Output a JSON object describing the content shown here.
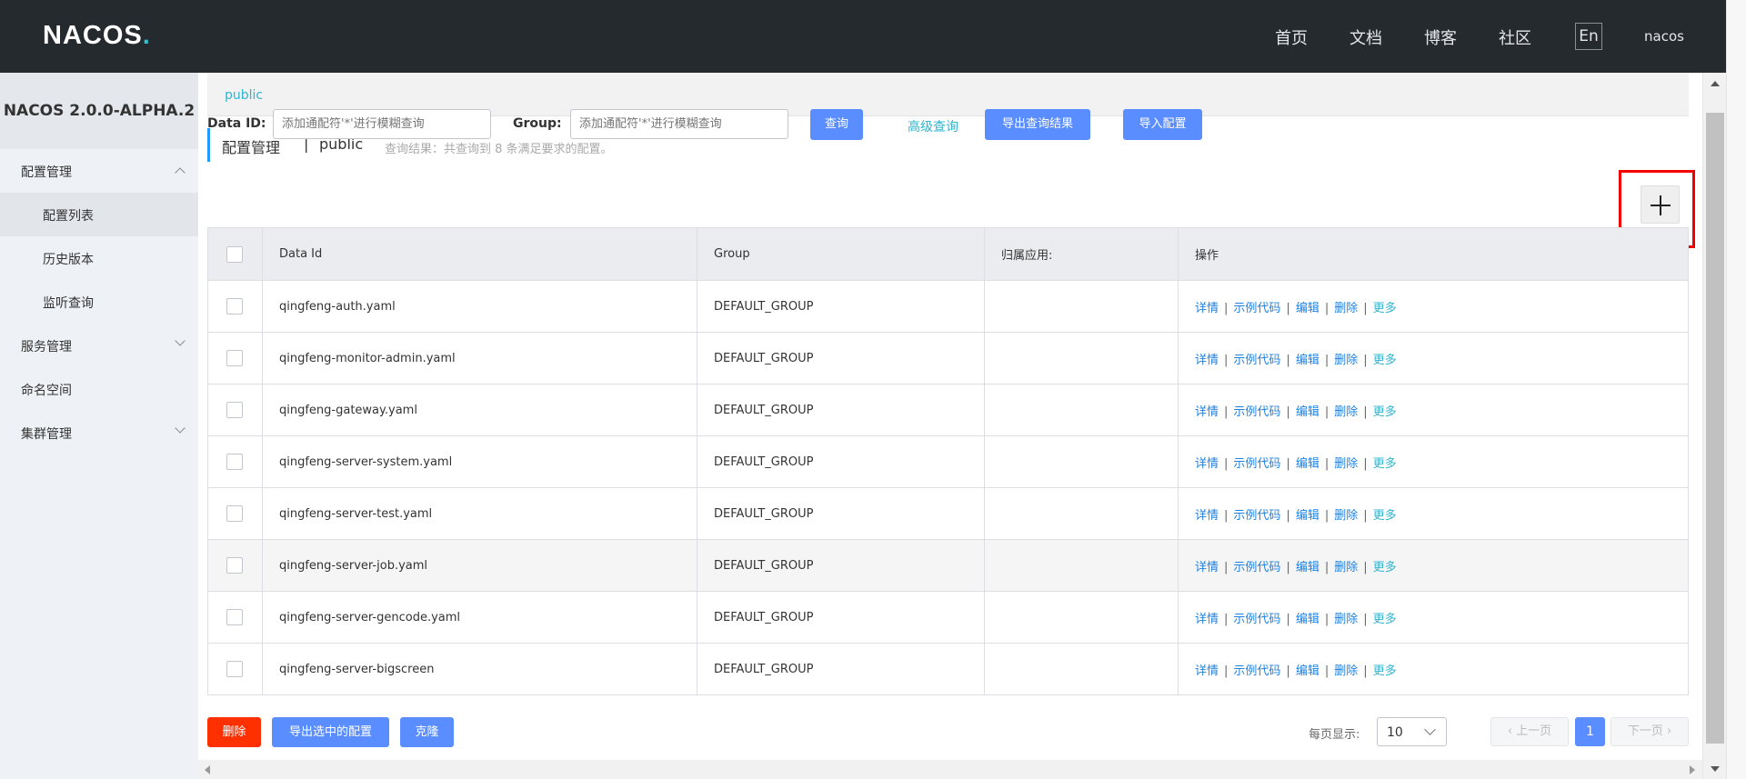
{
  "header": {
    "logo_text": "NACOS",
    "logo_dot": ".",
    "nav": [
      "首页",
      "文档",
      "博客",
      "社区"
    ],
    "lang": "En",
    "user": "nacos"
  },
  "sidebar": {
    "title": "NACOS 2.0.0-ALPHA.2",
    "items": [
      {
        "label": "配置管理",
        "expanded": true
      },
      {
        "label": "配置列表",
        "active": true
      },
      {
        "label": "历史版本"
      },
      {
        "label": "监听查询"
      },
      {
        "label": "服务管理",
        "expanded": false
      },
      {
        "label": "命名空间"
      },
      {
        "label": "集群管理",
        "expanded": false
      }
    ]
  },
  "namespace_bar": {
    "current": "public"
  },
  "page": {
    "title": "配置管理",
    "separator": "|",
    "namespace": "public",
    "result_text": "查询结果：共查询到 8 条满足要求的配置。"
  },
  "search": {
    "data_id_label": "Data ID:",
    "data_id_placeholder": "添加通配符'*'进行模糊查询",
    "group_label": "Group:",
    "group_placeholder": "添加通配符'*'进行模糊查询",
    "query_button": "查询",
    "advanced_query": "高级查询",
    "export_results": "导出查询结果",
    "import_config": "导入配置"
  },
  "table": {
    "headers": [
      "Data Id",
      "Group",
      "归属应用:",
      "操作"
    ],
    "rows": [
      {
        "data_id": "qingfeng-auth.yaml",
        "group": "DEFAULT_GROUP",
        "app": ""
      },
      {
        "data_id": "qingfeng-monitor-admin.yaml",
        "group": "DEFAULT_GROUP",
        "app": ""
      },
      {
        "data_id": "qingfeng-gateway.yaml",
        "group": "DEFAULT_GROUP",
        "app": ""
      },
      {
        "data_id": "qingfeng-server-system.yaml",
        "group": "DEFAULT_GROUP",
        "app": ""
      },
      {
        "data_id": "qingfeng-server-test.yaml",
        "group": "DEFAULT_GROUP",
        "app": ""
      },
      {
        "data_id": "qingfeng-server-job.yaml",
        "group": "DEFAULT_GROUP",
        "app": ""
      },
      {
        "data_id": "qingfeng-server-gencode.yaml",
        "group": "DEFAULT_GROUP",
        "app": ""
      },
      {
        "data_id": "qingfeng-server-bigscreen",
        "group": "DEFAULT_GROUP",
        "app": ""
      }
    ],
    "actions": {
      "detail": "详情",
      "sample_code": "示例代码",
      "edit": "编辑",
      "delete": "删除",
      "more": "更多",
      "sep": "|"
    }
  },
  "footer": {
    "delete_button": "删除",
    "export_selected_button": "导出选中的配置",
    "clone_button": "克隆",
    "page_size_label": "每页显示:",
    "page_size": "10",
    "prev": "上一页",
    "current_page": "1",
    "next": "下一页"
  },
  "colors": {
    "primary": "#5a8dff",
    "danger": "#ff3000",
    "link": "#1f81e0",
    "highlight": "#f20000",
    "header_bg": "#252a2f"
  },
  "icons": [
    "add-icon",
    "chevron-up-icon",
    "chevron-down-icon",
    "chevron-left-icon",
    "chevron-right-icon"
  ]
}
